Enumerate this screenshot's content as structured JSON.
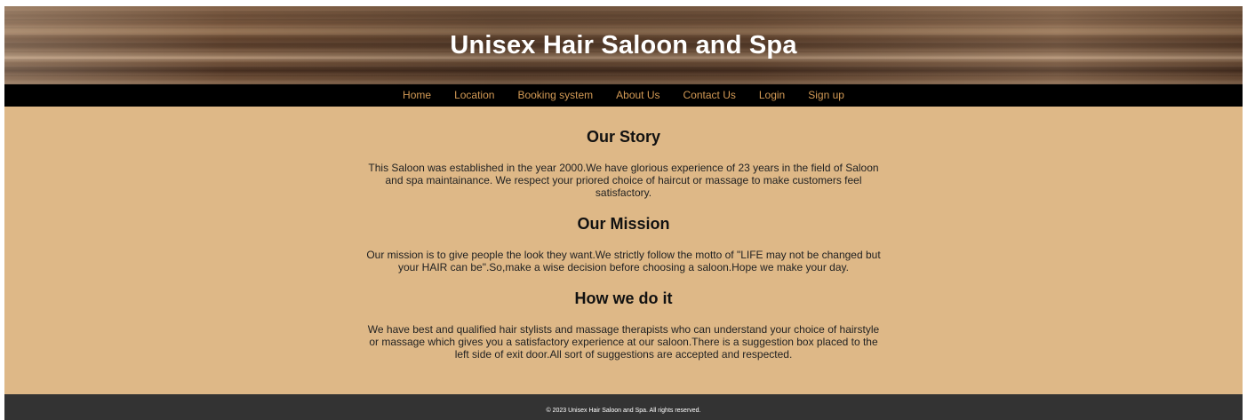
{
  "header": {
    "title": "Unisex Hair Saloon and Spa"
  },
  "nav": {
    "items": [
      {
        "label": "Home"
      },
      {
        "label": "Location"
      },
      {
        "label": "Booking system"
      },
      {
        "label": "About Us"
      },
      {
        "label": "Contact Us"
      },
      {
        "label": "Login"
      },
      {
        "label": "Sign up"
      }
    ]
  },
  "main": {
    "sections": [
      {
        "heading": "Our Story",
        "text": "This Saloon was established in the year 2000.We have glorious experience of 23 years in the field of Saloon and spa maintainance. We respect your priored choice of haircut or massage to make customers feel satisfactory."
      },
      {
        "heading": "Our Mission",
        "text": "Our mission is to give people the look they want.We strictly follow the motto of \"LIFE may not be changed but your HAIR can be\".So,make a wise decision before choosing a saloon.Hope we make your day."
      },
      {
        "heading": "How we do it",
        "text": "We have best and qualified hair stylists and massage therapists who can understand your choice of hairstyle or massage which gives you a satisfactory experience at our saloon.There is a suggestion box placed to the left side of exit door.All sort of suggestions are accepted and respected."
      }
    ]
  },
  "footer": {
    "copyright": "© 2023 Unisex Hair Saloon and Spa. All rights reserved."
  },
  "colors": {
    "nav_link": "#d39a55",
    "content_bg": "#deb887",
    "nav_bg": "#000000",
    "footer_bg": "#333333"
  }
}
